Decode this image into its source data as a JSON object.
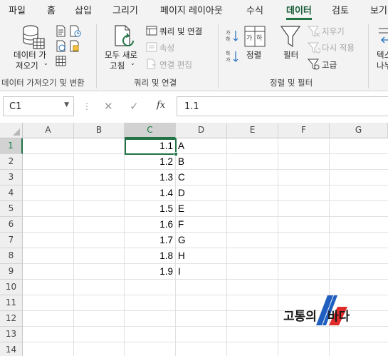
{
  "tabs": [
    "파일",
    "홈",
    "삽입",
    "그리기",
    "페이지 레이아웃",
    "수식",
    "데이터",
    "검토",
    "보기"
  ],
  "active_tab": "데이터",
  "ribbon": {
    "get_data": {
      "label_line1": "데이터 가",
      "label_line2": "져오기",
      "group": "데이터 가져오기 및 변환"
    },
    "refresh": {
      "label_line1": "모두 새로",
      "label_line2": "고침",
      "queries_connections": "쿼리 및 연결",
      "properties": "속성",
      "edit_links": "연결 편집",
      "group": "쿼리 및 연결"
    },
    "sort": {
      "sort_label": "정렬",
      "filter_label": "필터",
      "clear": "지우기",
      "reapply": "다시 적용",
      "advanced": "고급",
      "group": "정렬 및 필터"
    },
    "text_col_partial_1": "텍스",
    "text_col_partial_2": "나누"
  },
  "formula_bar": {
    "name_box": "C1",
    "formula": "1.1",
    "fx": "fx"
  },
  "columns": [
    "A",
    "B",
    "C",
    "D",
    "E",
    "F",
    "G"
  ],
  "rows": [
    "1",
    "2",
    "3",
    "4",
    "5",
    "6",
    "7",
    "8",
    "9",
    "10",
    "11",
    "12",
    "13",
    "14"
  ],
  "cells": {
    "C": [
      "1.1",
      "1.2",
      "1.3",
      "1.4",
      "1.5",
      "1.6",
      "1.7",
      "1.8",
      "1.9"
    ],
    "D": [
      "A",
      "B",
      "C",
      "D",
      "E",
      "F",
      "G",
      "H",
      "I"
    ]
  },
  "selected_cell": "C1",
  "watermark": {
    "part1": "고통의",
    "part2": "바다"
  },
  "colors": {
    "accent": "#217346",
    "logo_blue": "#1f5fbf",
    "logo_red": "#e02b2b"
  }
}
